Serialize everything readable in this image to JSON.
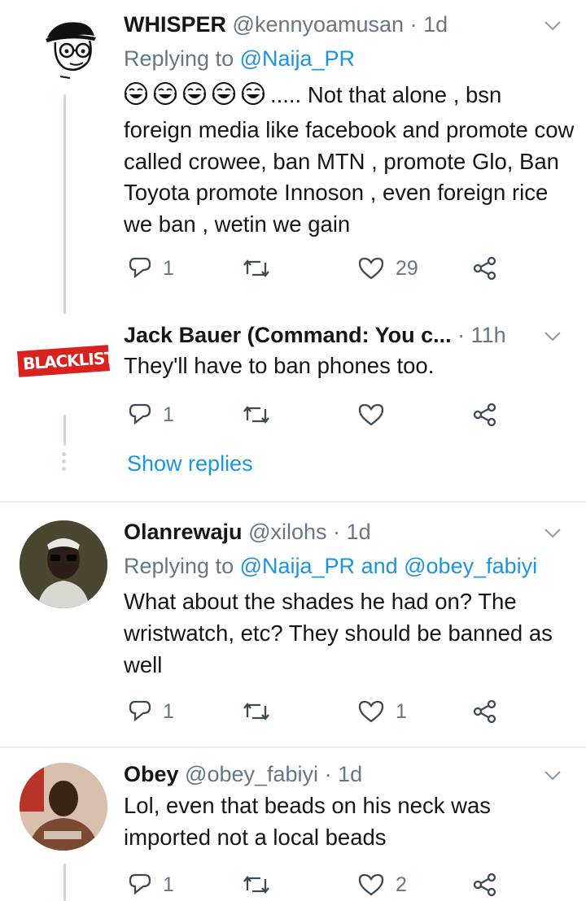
{
  "tweets": [
    {
      "name": "WHISPER",
      "handle": "@kennyoamusan",
      "dot": "·",
      "time": "1d",
      "replying_prefix": "Replying to ",
      "replying_to": "@Naija_PR",
      "replying_join": "",
      "replying_to_2": "",
      "emoji_prefix": "😂😂😂😂😂",
      "text": "..... Not that alone , bsn foreign media like facebook and promote cow called crowee, ban MTN , promote Glo, Ban Toyota promote Innoson , even foreign rice we ban , wetin we gain",
      "replies": "1",
      "retweets": "",
      "likes": "29"
    },
    {
      "name": "Jack Bauer (Command: You c...",
      "handle": "",
      "dot": "·",
      "time": "11h",
      "avatar_text": "BLACKLIST",
      "text": "They'll have to ban phones too.",
      "replies": "1",
      "retweets": "",
      "likes": ""
    },
    {
      "name": "Olanrewaju",
      "handle": "@xilohs",
      "dot": "·",
      "time": "1d",
      "replying_prefix": "Replying to ",
      "replying_to": "@Naija_PR",
      "replying_join": " and ",
      "replying_to_2": "@obey_fabiyi",
      "text": "What about the shades he had on? The wristwatch, etc? They should be banned as well",
      "replies": "1",
      "retweets": "",
      "likes": "1"
    },
    {
      "name": "Obey",
      "handle": "@obey_fabiyi",
      "dot": "·",
      "time": "1d",
      "text": "Lol, even that beads on his neck was imported not a local beads",
      "replies": "1",
      "retweets": "",
      "likes": "2"
    }
  ],
  "show_replies": "Show replies",
  "colors": {
    "link": "#1b95e0",
    "muted": "#657786",
    "line": "#ccd6dd",
    "divider": "#e6ecf0"
  },
  "icons": [
    "reply-icon",
    "retweet-icon",
    "like-icon",
    "share-icon",
    "chevron-down-icon"
  ]
}
